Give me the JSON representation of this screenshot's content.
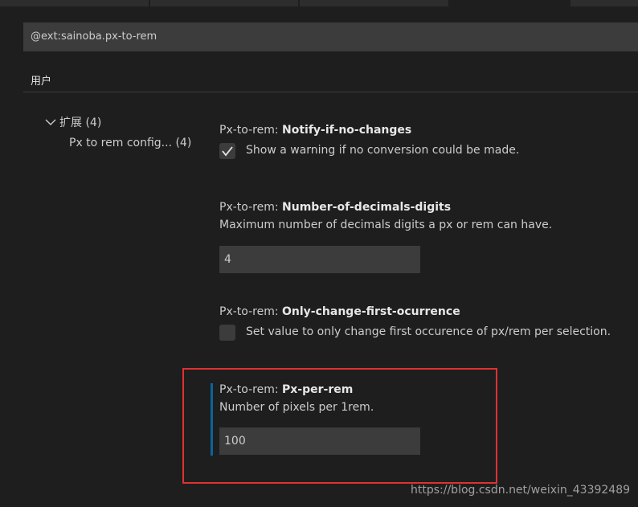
{
  "search": {
    "value": "@ext:sainoba.px-to-rem"
  },
  "scope_tab": {
    "label": "用户"
  },
  "toc": {
    "group_label": "扩展 (4)",
    "item_label": "Px to rem config... (4)"
  },
  "settings": [
    {
      "category": "Px-to-rem: ",
      "name": "Notify-if-no-changes",
      "description": "Show a warning if no conversion could be made.",
      "checked": true
    },
    {
      "category": "Px-to-rem: ",
      "name": "Number-of-decimals-digits",
      "description": "Maximum number of decimals digits a px or rem can have.",
      "value": "4"
    },
    {
      "category": "Px-to-rem: ",
      "name": "Only-change-first-ocurrence",
      "description": "Set value to only change first occurence of px/rem per selection.",
      "checked": false
    },
    {
      "category": "Px-to-rem: ",
      "name": "Px-per-rem",
      "description": "Number of pixels per 1rem.",
      "value": "100"
    }
  ],
  "watermark": "https://blog.csdn.net/weixin_43392489",
  "colors": {
    "background": "#1e1e1e",
    "input_bg": "#3c3c3c",
    "focus_bar": "#0e639c",
    "annotation_red": "#e03131"
  }
}
